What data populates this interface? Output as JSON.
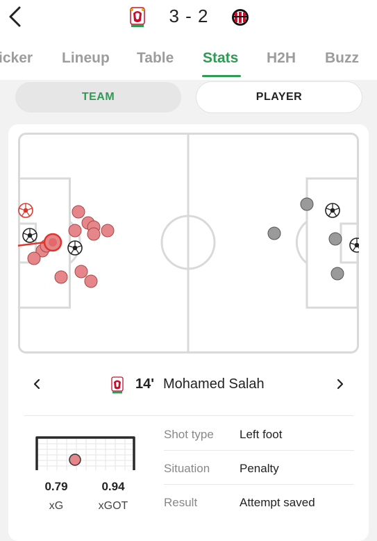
{
  "match": {
    "home_team": "Liverpool",
    "away_team": "AC Milan",
    "score": "3 - 2"
  },
  "tabs": [
    {
      "label": "icker",
      "active": false
    },
    {
      "label": "Lineup",
      "active": false
    },
    {
      "label": "Table",
      "active": false
    },
    {
      "label": "Stats",
      "active": true
    },
    {
      "label": "H2H",
      "active": false
    },
    {
      "label": "Buzz",
      "active": false
    }
  ],
  "segment": {
    "team_label": "TEAM",
    "player_label": "PLAYER",
    "selected": "TEAM"
  },
  "shot_map": {
    "liverpool_shot_color": "#e5868a",
    "milan_shot_color": "#9a9a9a",
    "selected_shot_color": "#e0352a",
    "pitch_line_color": "#d9d9d9"
  },
  "selected_shot": {
    "minute": "14'",
    "player": "Mohamed Salah",
    "xg": "0.79",
    "xg_label": "xG",
    "xgot": "0.94",
    "xgot_label": "xGOT",
    "details": [
      {
        "label": "Shot type",
        "value": "Left foot"
      },
      {
        "label": "Situation",
        "value": "Penalty"
      },
      {
        "label": "Result",
        "value": "Attempt saved"
      }
    ]
  },
  "icons": {
    "back": "chevron-left-icon",
    "prev": "chevron-left-icon",
    "next": "chevron-right-icon",
    "goal": "soccer-ball-icon"
  }
}
